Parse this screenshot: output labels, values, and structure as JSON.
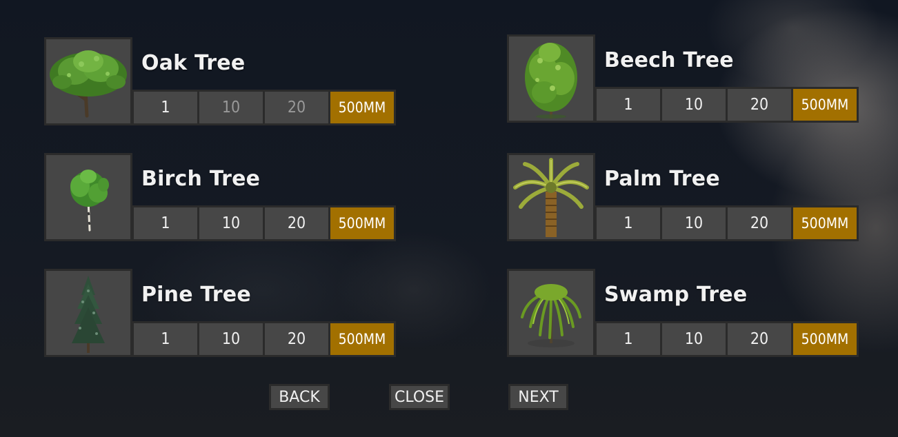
{
  "trees": [
    {
      "name": "Oak Tree",
      "icon": "oak-tree-icon",
      "quantities": [
        "1",
        "10",
        "20"
      ],
      "buy_label": "500MM"
    },
    {
      "name": "Beech Tree",
      "icon": "beech-tree-icon",
      "quantities": [
        "1",
        "10",
        "20"
      ],
      "buy_label": "500MM"
    },
    {
      "name": "Birch Tree",
      "icon": "birch-tree-icon",
      "quantities": [
        "1",
        "10",
        "20"
      ],
      "buy_label": "500MM"
    },
    {
      "name": "Palm Tree",
      "icon": "palm-tree-icon",
      "quantities": [
        "1",
        "10",
        "20"
      ],
      "buy_label": "500MM"
    },
    {
      "name": "Pine Tree",
      "icon": "pine-tree-icon",
      "quantities": [
        "1",
        "10",
        "20"
      ],
      "buy_label": "500MM"
    },
    {
      "name": "Swamp Tree",
      "icon": "swamp-tree-icon",
      "quantities": [
        "1",
        "10",
        "20"
      ],
      "buy_label": "500MM"
    }
  ],
  "nav": {
    "back_label": "BACK",
    "close_label": "CLOSE",
    "next_label": "NEXT"
  },
  "colors": {
    "buy_accent": "#a27000",
    "button_bg": "#474747",
    "frame": "#2b2b2b",
    "disabled_text": "#9a9a9a"
  }
}
